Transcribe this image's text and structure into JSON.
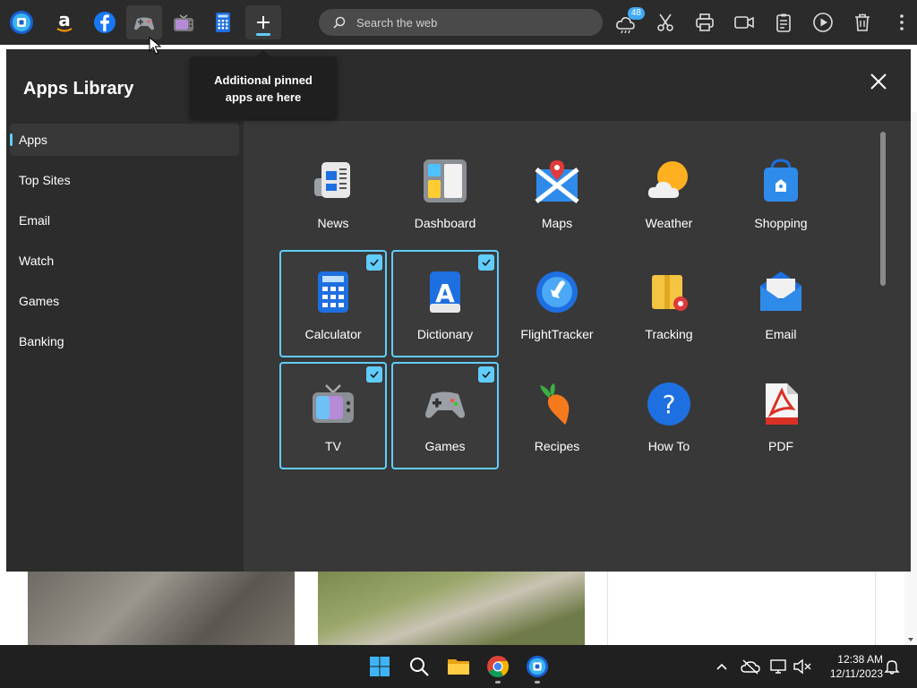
{
  "topbar": {
    "pinned": [
      {
        "name": "outlook-icon"
      },
      {
        "name": "amazon-icon"
      },
      {
        "name": "facebook-icon"
      },
      {
        "name": "games-icon"
      },
      {
        "name": "tv-icon"
      },
      {
        "name": "calculator-icon"
      }
    ],
    "search_placeholder": "Search the web",
    "weather_badge": "48"
  },
  "panel": {
    "title": "Apps Library",
    "tooltip_line1": "Additional pinned",
    "tooltip_line2": "apps are here",
    "categories": [
      {
        "label": "Apps",
        "selected": true
      },
      {
        "label": "Top Sites",
        "selected": false
      },
      {
        "label": "Email",
        "selected": false
      },
      {
        "label": "Watch",
        "selected": false
      },
      {
        "label": "Games",
        "selected": false
      },
      {
        "label": "Banking",
        "selected": false
      }
    ],
    "apps": [
      {
        "label": "News",
        "icon": "news-icon",
        "checked": false
      },
      {
        "label": "Dashboard",
        "icon": "dashboard-icon",
        "checked": false
      },
      {
        "label": "Maps",
        "icon": "maps-icon",
        "checked": false
      },
      {
        "label": "Weather",
        "icon": "weather-icon",
        "checked": false
      },
      {
        "label": "Shopping",
        "icon": "shopping-icon",
        "checked": false
      },
      {
        "label": "Calculator",
        "icon": "calculator-icon",
        "checked": true
      },
      {
        "label": "Dictionary",
        "icon": "dictionary-icon",
        "checked": true
      },
      {
        "label": "FlightTracker",
        "icon": "flight-tracker-icon",
        "checked": false
      },
      {
        "label": "Tracking",
        "icon": "tracking-icon",
        "checked": false
      },
      {
        "label": "Email",
        "icon": "email-icon",
        "checked": false
      },
      {
        "label": "TV",
        "icon": "tv-icon",
        "checked": true
      },
      {
        "label": "Games",
        "icon": "games-icon",
        "checked": true
      },
      {
        "label": "Recipes",
        "icon": "recipes-icon",
        "checked": false
      },
      {
        "label": "How To",
        "icon": "how-to-icon",
        "checked": false
      },
      {
        "label": "PDF",
        "icon": "pdf-icon",
        "checked": false
      }
    ]
  },
  "taskbar": {
    "time": "12:38 AM",
    "date": "12/11/2023"
  },
  "colors": {
    "accent": "#60cdff",
    "panel": "#2c2c2c",
    "content": "#383838"
  }
}
